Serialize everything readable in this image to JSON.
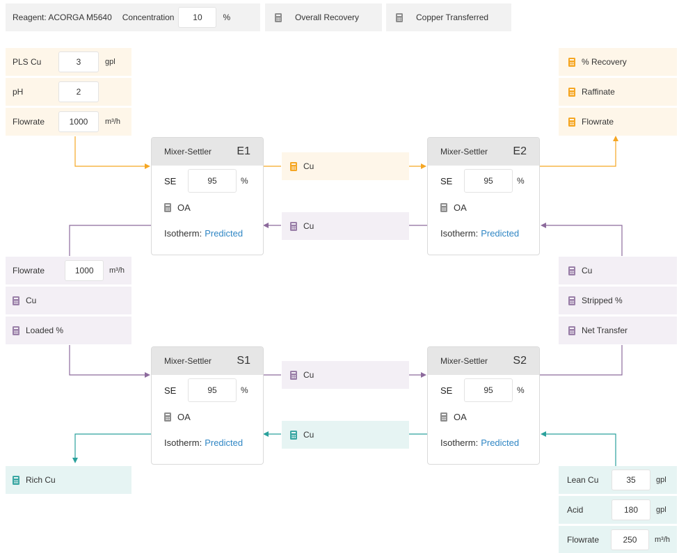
{
  "top": {
    "reagent_label": "Reagent: ACORGA M5640",
    "concentration_label": "Concentration",
    "concentration_value": "10",
    "concentration_unit": "%",
    "overall_recovery": "Overall Recovery",
    "copper_transferred": "Copper Transferred"
  },
  "pls": {
    "cu_label": "PLS Cu",
    "cu_value": "3",
    "cu_unit": "gpl",
    "ph_label": "pH",
    "ph_value": "2",
    "flow_label": "Flowrate",
    "flow_value": "1000",
    "flow_unit": "m³/h"
  },
  "raffinate_out": {
    "recovery": "% Recovery",
    "raffinate": "Raffinate",
    "flowrate": "Flowrate"
  },
  "organic_left": {
    "flow_label": "Flowrate",
    "flow_value": "1000",
    "flow_unit": "m³/h",
    "cu": "Cu",
    "loaded": "Loaded %"
  },
  "organic_right": {
    "cu": "Cu",
    "stripped": "Stripped %",
    "net_transfer": "Net Transfer"
  },
  "rich": {
    "label": "Rich Cu"
  },
  "lean": {
    "cu_label": "Lean Cu",
    "cu_value": "35",
    "cu_unit": "gpl",
    "acid_label": "Acid",
    "acid_value": "180",
    "acid_unit": "gpl",
    "flow_label": "Flowrate",
    "flow_value": "250",
    "flow_unit": "m³/h"
  },
  "streams": {
    "e1_e2_aq": "Cu",
    "e2_e1_org": "Cu",
    "s1_s2_org": "Cu",
    "s2_s1_aq": "Cu"
  },
  "settlers": {
    "common": {
      "title": "Mixer-Settler",
      "se_label": "SE",
      "se_unit": "%",
      "oa_label": "OA",
      "iso_label": "Isotherm:",
      "iso_value": "Predicted"
    },
    "e1": {
      "id": "E1",
      "se": "95"
    },
    "e2": {
      "id": "E2",
      "se": "95"
    },
    "s1": {
      "id": "S1",
      "se": "95"
    },
    "s2": {
      "id": "S2",
      "se": "95"
    }
  },
  "colors": {
    "orange": "#f5a623",
    "purple": "#8c6a9c",
    "teal": "#2aa19c",
    "link": "#2f86c4"
  },
  "icons": [
    "calculator-icon"
  ]
}
